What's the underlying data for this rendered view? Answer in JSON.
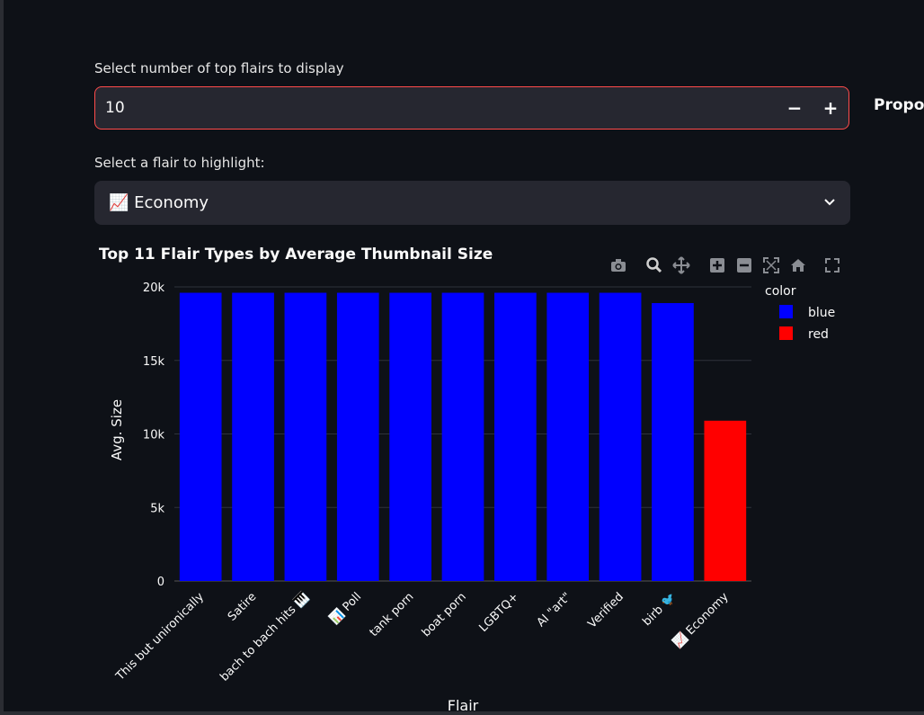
{
  "controls": {
    "top_n_label": "Select number of top flairs to display",
    "top_n_value": "10",
    "minus": "−",
    "plus": "+",
    "highlight_label": "Select a flair to highlight:",
    "highlight_value": "📈 Economy",
    "side_label": "Propor"
  },
  "colors": {
    "background": "#0e1117",
    "input_bg": "#262730",
    "accent": "#ff4b4b",
    "blue": "#0000ff",
    "red": "#ff0000"
  },
  "modebar_icons": [
    "camera-icon",
    "zoom-icon",
    "pan-icon",
    "zoom-in-icon",
    "zoom-out-icon",
    "autoscale-icon",
    "reset-axes-icon",
    "fullscreen-icon"
  ],
  "chart_data": {
    "type": "bar",
    "title": "Top 11 Flair Types by Average Thumbnail Size",
    "xlabel": "Flair",
    "ylabel": "Avg. Size",
    "ylim": [
      0,
      20000
    ],
    "yticks": [
      0,
      5000,
      10000,
      15000,
      20000
    ],
    "ytick_labels": [
      "0",
      "5k",
      "10k",
      "15k",
      "20k"
    ],
    "categories": [
      "This but unironically",
      "Satire",
      "bach to bach hits 🎹",
      "📊 Poll",
      "tank porn",
      "boat porn",
      "LGBTQ+",
      "AI \"art\"",
      "Verified",
      "birb 🐦",
      "📈 Economy"
    ],
    "values": [
      19600,
      19600,
      19600,
      19600,
      19600,
      19600,
      19600,
      19600,
      19600,
      18900,
      10900
    ],
    "bar_colors": [
      "blue",
      "blue",
      "blue",
      "blue",
      "blue",
      "blue",
      "blue",
      "blue",
      "blue",
      "blue",
      "red"
    ],
    "legend": {
      "title": "color",
      "position": "right",
      "entries": [
        {
          "name": "blue",
          "color": "#0000ff"
        },
        {
          "name": "red",
          "color": "#ff0000"
        }
      ]
    },
    "grid": true
  }
}
